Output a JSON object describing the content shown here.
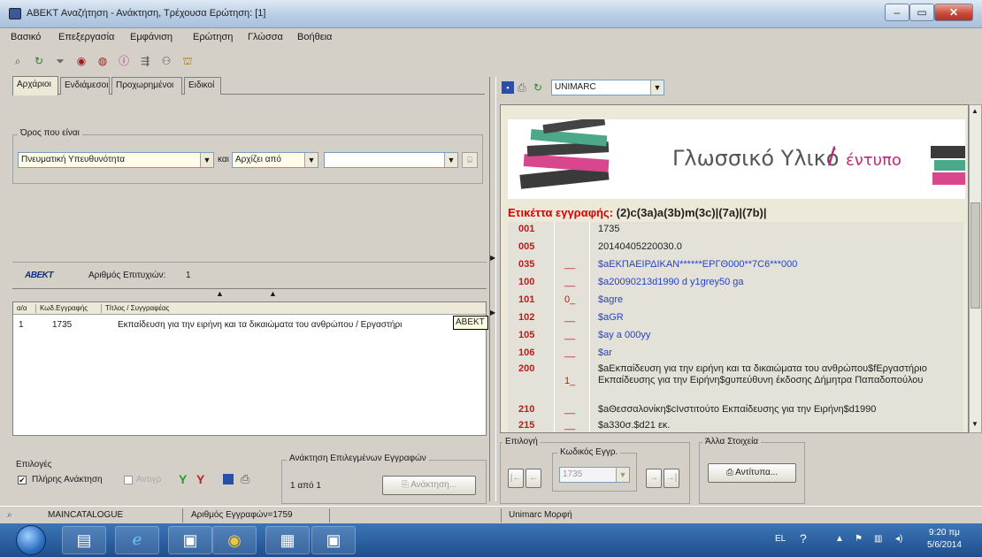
{
  "window": {
    "title": "ABEKT Αναζήτηση - Ανάκτηση, Τρέχουσα Ερώτηση: [1]",
    "minimize": "–",
    "maximize": "▭",
    "close": "✕"
  },
  "menu": [
    "Βασικό",
    "Επεξεργασία",
    "Εμφάνιση",
    "Ερώτηση",
    "Γλώσσα",
    "Βοήθεια"
  ],
  "tabs": [
    "Αρχάριοι",
    "Ενδιάμεσοι",
    "Προχωρημένοι",
    "Ειδικοί"
  ],
  "search": {
    "group_label": "Όρος που είναι",
    "field": "Πνευματική Υπευθυνότητα",
    "connector": "και",
    "match": "Αρχίζει από",
    "term": ""
  },
  "hits": {
    "logo": "ABEKT",
    "label": "Αριθμός Επιτυχιών:",
    "count": "1"
  },
  "list": {
    "headers": [
      "α/α",
      "Κωδ.Εγγραφής",
      "Τίτλος / Συγγραφέας"
    ],
    "rows": [
      {
        "n": "1",
        "code": "1735",
        "title": "Εκπαίδευση για την ειρήνη και τα δικαιώματα του ανθρώπου / Εργαστήρι"
      }
    ],
    "tooltip": "ABEKT"
  },
  "right": {
    "format": "UNIMARC"
  },
  "banner": {
    "title": "Γλωσσικό Υλικό",
    "slash": "/",
    "subtitle": "έντυπο"
  },
  "record": {
    "label": "Ετικέττα εγγραφής:",
    "leader": "(2)c(3a)a(3b)m(3c)|(7a)|(7b)|",
    "fields": [
      {
        "tag": "001",
        "ind": "",
        "val": "1735"
      },
      {
        "tag": "005",
        "ind": "",
        "val": "20140405220030.0"
      },
      {
        "tag": "035",
        "ind": "__",
        "val": "$aΕΚΠΑΕΙΡΔΙΚΑΝ******ΕΡΓΘ000**7C6***000"
      },
      {
        "tag": "100",
        "ind": "__",
        "val": "$a20090213d1990 d y1grey50 ga"
      },
      {
        "tag": "101",
        "ind": "0_",
        "val": "$agre"
      },
      {
        "tag": "102",
        "ind": "__",
        "val": "$aGR"
      },
      {
        "tag": "105",
        "ind": "__",
        "val": "$ay a 000yy"
      },
      {
        "tag": "106",
        "ind": "__",
        "val": "$ar"
      },
      {
        "tag": "200",
        "ind": "1_",
        "val": "$aΕκπαίδευση για την ειρήνη και τα δικαιώματα του ανθρώπου$fΕργαστήριο Εκπαίδευσης για την Ειρήνη$gυπεύθυνη έκδοσης Δήμητρα Παπαδοπούλου"
      },
      {
        "tag": "210",
        "ind": "__",
        "val": "$aΘεσσαλονίκη$cΙνστιτούτο Εκπαίδευσης για την Ειρήνη$d1990"
      },
      {
        "tag": "215",
        "ind": "__",
        "val": "$a330σ.$d21 εκ."
      }
    ]
  },
  "options": {
    "label": "Επιλογές",
    "full_retrieval": "Πλήρης Ανάκτηση",
    "second": "Αντιγρ"
  },
  "selected": {
    "label": "Ανάκτηση Επιλεγμένων Εγγραφών",
    "range": "1 από 1",
    "button": "Ανάκτηση..."
  },
  "selection": {
    "label": "Επιλογή",
    "code_label": "Κωδικός Εγγρ.",
    "code_value": "1735"
  },
  "other": {
    "label": "Άλλα Στοιχεία",
    "print_button": "Αντίτυπα..."
  },
  "status": {
    "catalogue": "MAINCATALOGUE",
    "records": "Αριθμός Εγγραφών=1759",
    "format": "Unimarc Μορφή"
  },
  "tray": {
    "lang": "EL",
    "time": "9:20 πμ",
    "date": "5/6/2014"
  }
}
